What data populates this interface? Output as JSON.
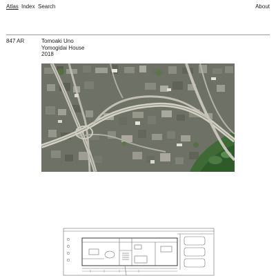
{
  "nav": {
    "items": [
      "Atlas",
      "Index",
      "Search"
    ],
    "about": "About"
  },
  "entry": {
    "code": "847 AR",
    "architect": "Tomoaki Uno",
    "title": "Yomogidai House",
    "year": "2018"
  },
  "images": [
    {
      "name": "aerial-photo",
      "kind": "satellite aerial view of dense city with highway interchange"
    },
    {
      "name": "floor-plan",
      "kind": "architectural floor plan drawing"
    }
  ]
}
